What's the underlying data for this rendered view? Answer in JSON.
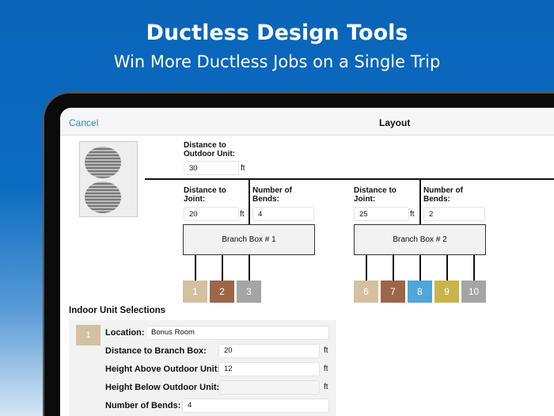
{
  "banner": {
    "title": "Ductless Design Tools",
    "subtitle": "Win More Ductless Jobs on a Single Trip"
  },
  "nav": {
    "cancel": "Cancel",
    "title": "Layout"
  },
  "outdoor": {
    "label": "Distance to Outdoor Unit:",
    "value": "30",
    "unit": "ft"
  },
  "branch_boxes": [
    {
      "name": "Branch Box # 1",
      "distance_label": "Distance to Joint:",
      "distance": "20",
      "unit": "ft",
      "bends_label": "Number of Bends:",
      "bends": "4"
    },
    {
      "name": "Branch Box # 2",
      "distance_label": "Distance to Joint:",
      "distance": "25",
      "unit": "ft",
      "bends_label": "Number of Bends:",
      "bends": "2"
    }
  ],
  "units": [
    {
      "n": "1",
      "color": "#d4c1a1"
    },
    {
      "n": "2",
      "color": "#9d6648"
    },
    {
      "n": "3",
      "color": "#a5a5a5"
    },
    {
      "n": "6",
      "color": "#d4c1a1"
    },
    {
      "n": "7",
      "color": "#9d6648"
    },
    {
      "n": "8",
      "color": "#4ea6d9"
    },
    {
      "n": "9",
      "color": "#c8b44a"
    },
    {
      "n": "10",
      "color": "#a5a5a5"
    }
  ],
  "indoor": {
    "heading": "Indoor Unit Selections",
    "unit_number": "1",
    "location_label": "Location:",
    "location": "Bonus Room",
    "dist_label": "Distance to Branch Box:",
    "dist": "20",
    "above_label": "Height Above Outdoor Unit:",
    "above": "12",
    "below_label": "Height Below Outdoor Unit:",
    "below": "",
    "bends_label": "Number of Bends:",
    "bends": "4",
    "unit": "ft"
  }
}
